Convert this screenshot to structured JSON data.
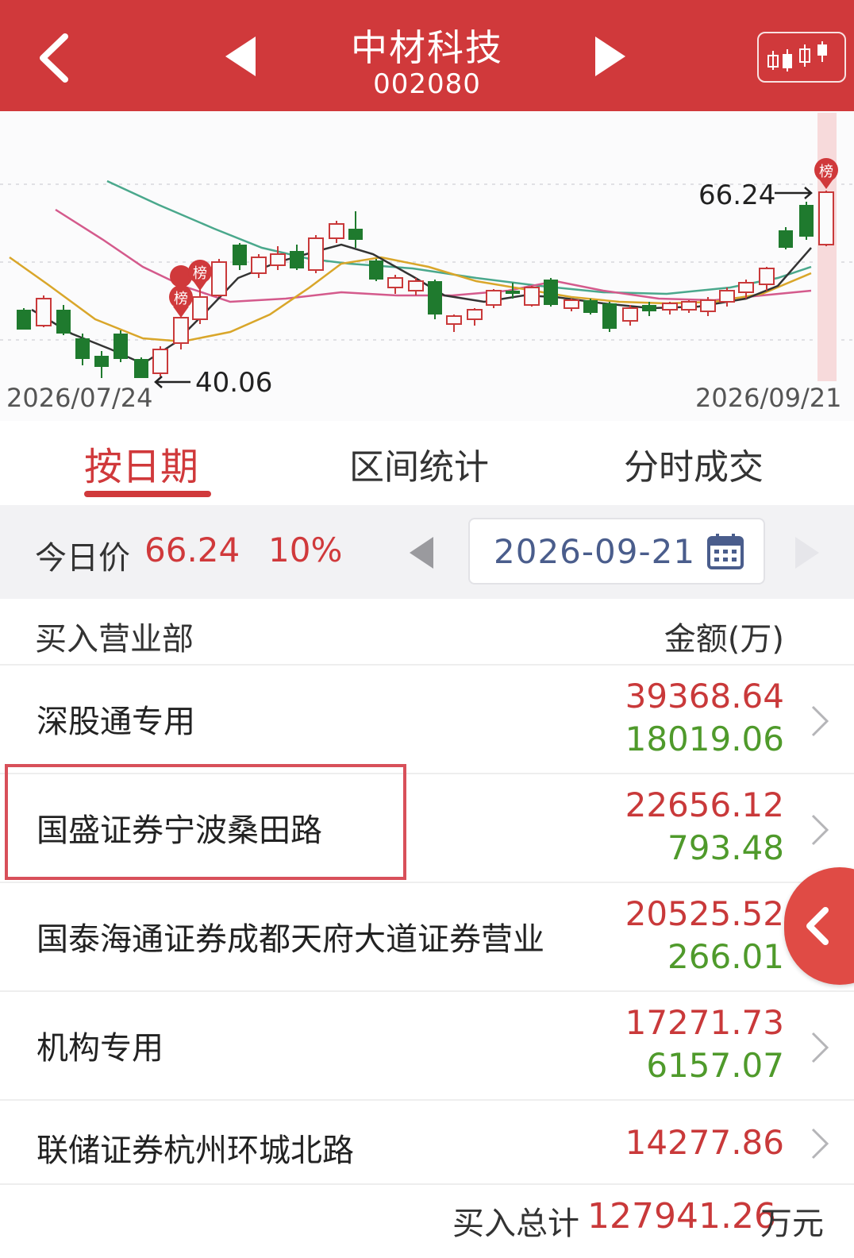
{
  "header": {
    "stock_name": "中材科技",
    "stock_code": "002080"
  },
  "chart": {
    "start_date": "2026/07/24",
    "end_date": "2026/09/21",
    "low_label": "40.06",
    "high_label": "66.24",
    "badge_char": "榜"
  },
  "tabs": [
    {
      "label": "按日期"
    },
    {
      "label": "区间统计"
    },
    {
      "label": "分时成交"
    }
  ],
  "price_bar": {
    "label": "今日价",
    "price": "66.24",
    "change": "10%",
    "date": "2026-09-21"
  },
  "list": {
    "header_left": "买入营业部",
    "header_right": "金额(万)",
    "rows": [
      {
        "name": "深股通专用",
        "buy": "39368.64",
        "sell": "18019.06"
      },
      {
        "name": "国盛证券宁波桑田路",
        "buy": "22656.12",
        "sell": "793.48"
      },
      {
        "name": "国泰海通证券成都天府大道证券营业",
        "buy": "20525.52",
        "sell": "266.01"
      },
      {
        "name": "机构专用",
        "buy": "17271.73",
        "sell": "6157.07"
      },
      {
        "name": "联储证券杭州环城北路",
        "buy": "14277.86",
        "sell": ""
      }
    ]
  },
  "footer": {
    "total_label": "买入总计",
    "total_value": "127941.26",
    "total_unit": "万元"
  },
  "colors": {
    "brand_red": "#d0393b",
    "up_red": "#c9393a",
    "down_green": "#1f7a2e",
    "sell_green": "#4f9a2b",
    "date_blue": "#4a5d8c"
  }
}
